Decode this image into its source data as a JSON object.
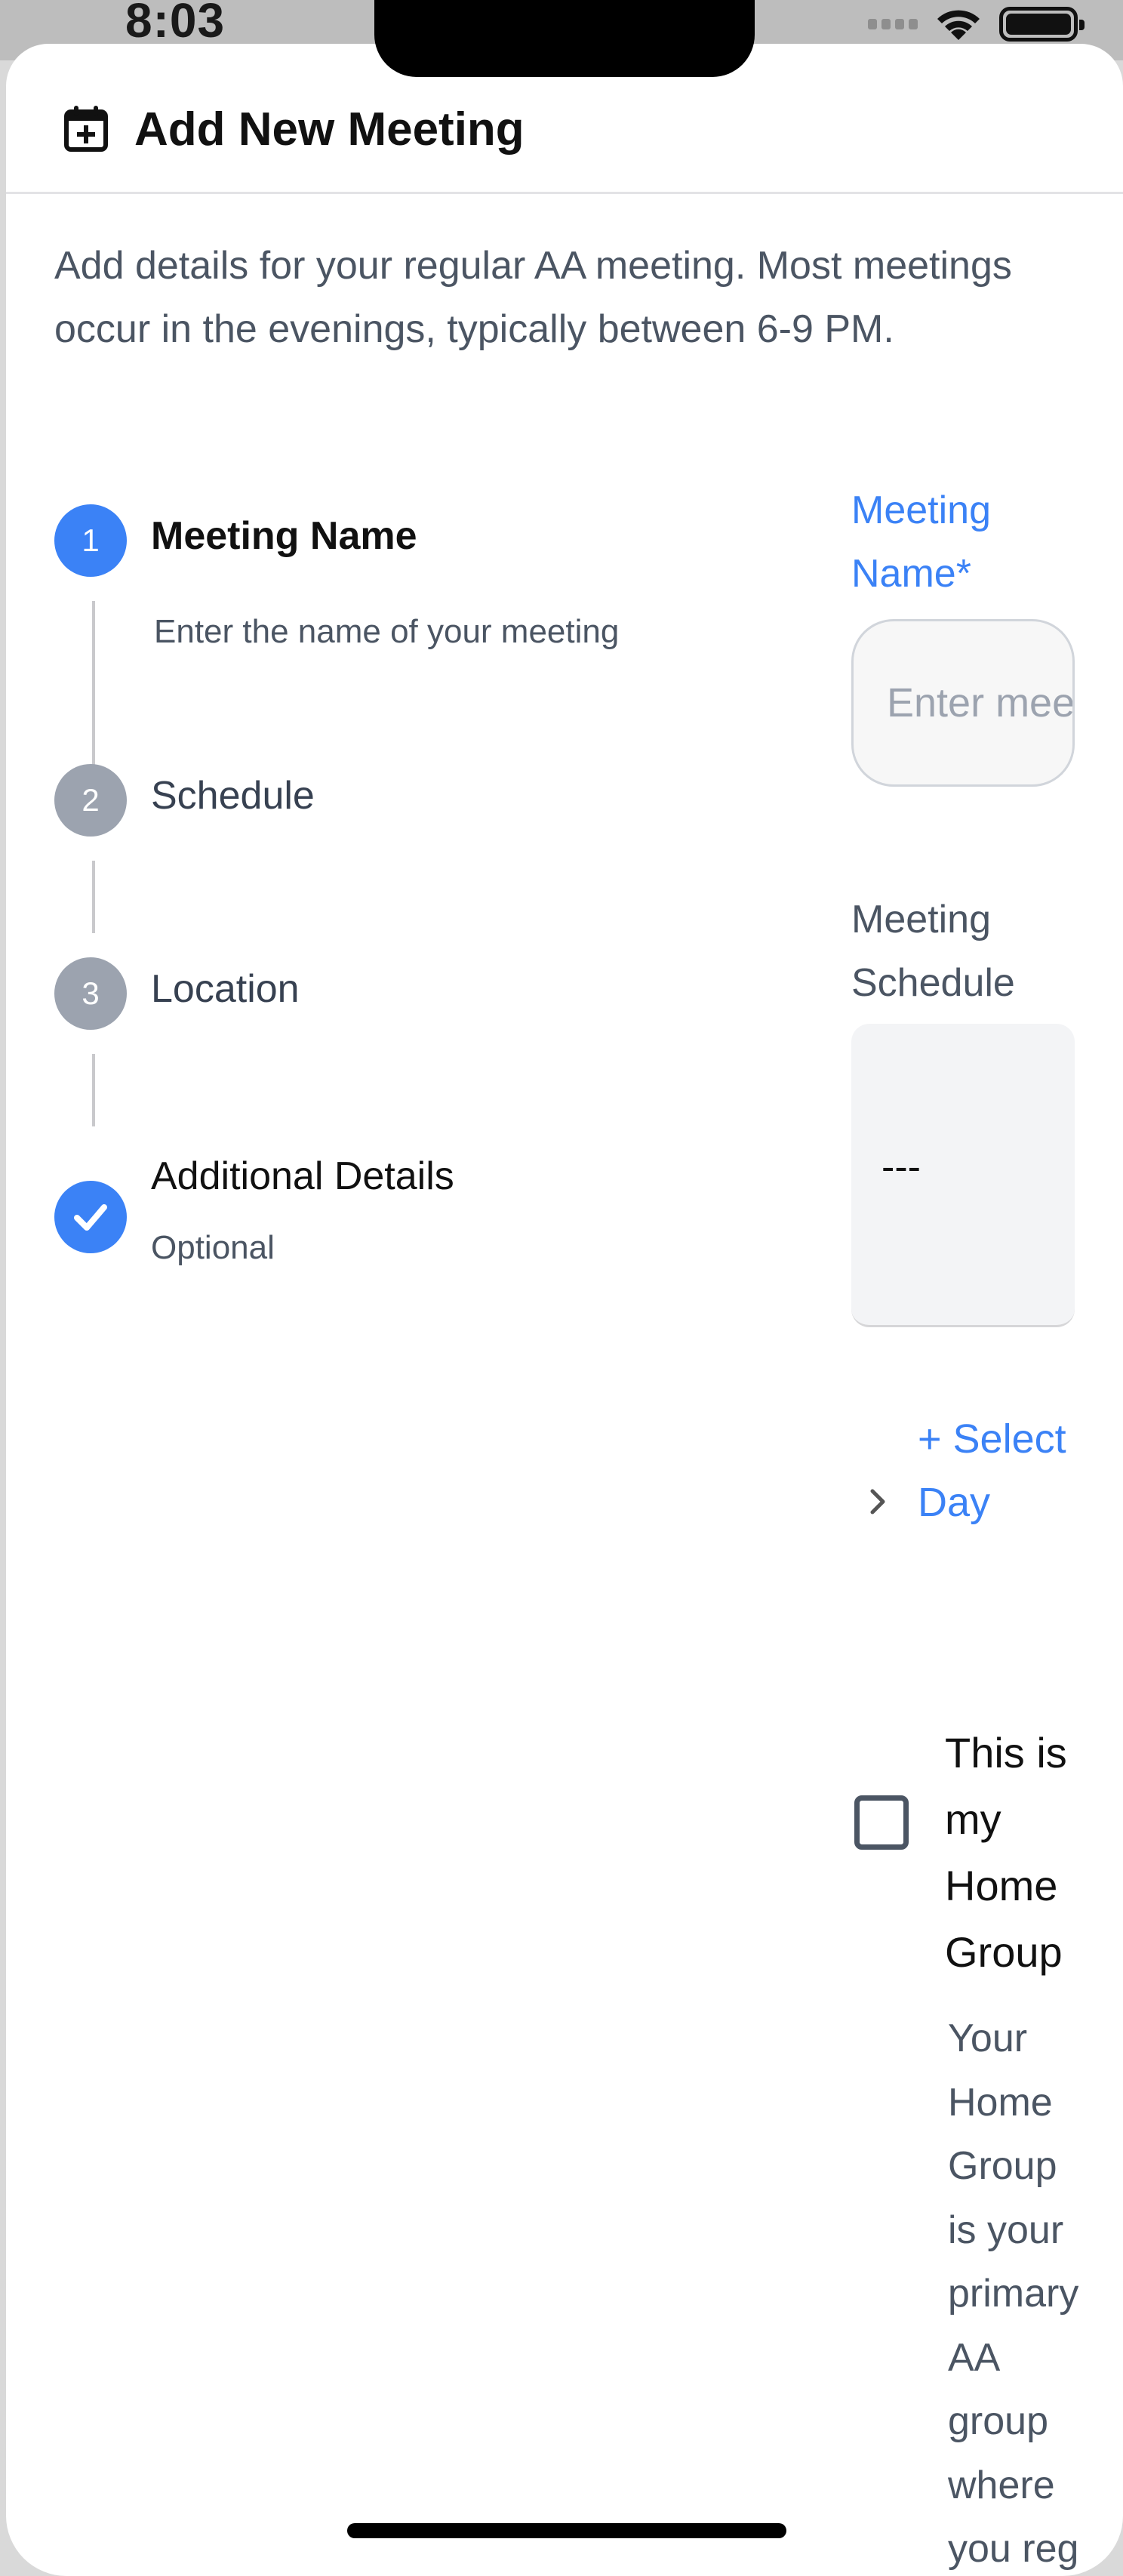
{
  "status_bar": {
    "time": "8:03"
  },
  "header": {
    "title": "Add New Meeting",
    "icon": "calendar-plus-icon"
  },
  "intro": "Add details for your regular AA meeting. Most meetings occur in the evenings, typically between 6-9 PM.",
  "steps": [
    {
      "number": "1",
      "title": "Meeting Name",
      "description": "Enter the name of your meeting",
      "state": "active"
    },
    {
      "number": "2",
      "title": "Schedule",
      "state": "inactive"
    },
    {
      "number": "3",
      "title": "Location",
      "state": "inactive"
    },
    {
      "number": "",
      "title": "Additional Details",
      "description": "Optional",
      "state": "completed",
      "icon": "check-icon"
    }
  ],
  "form": {
    "meeting_name_label": "Meeting Name*",
    "meeting_name_placeholder": "Enter meeting name",
    "meeting_name_value": "",
    "schedule_label": "Meeting Schedule",
    "schedule_value": "---",
    "select_day_label": "+ Select Day",
    "home_group_label": "This is my Home Group",
    "home_group_checked": false,
    "home_group_description": "Your Home Group is your primary AA group where you reg"
  },
  "colors": {
    "accent": "#3b82f6",
    "inactive": "#9ca3af",
    "text_secondary": "#4b5563"
  }
}
